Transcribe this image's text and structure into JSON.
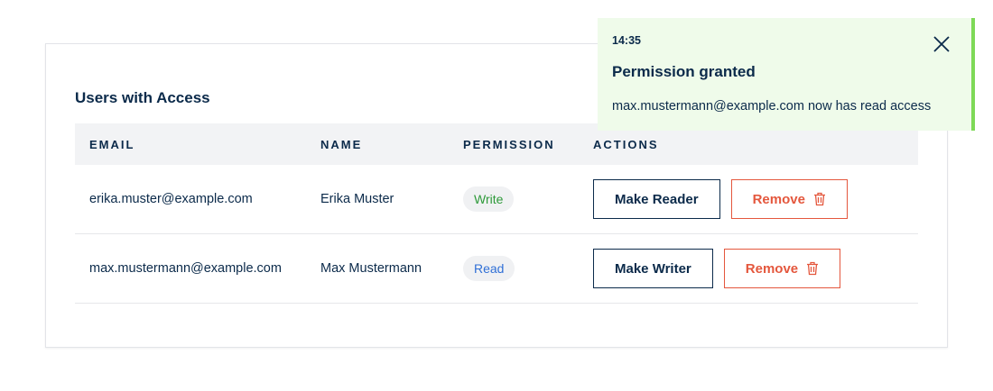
{
  "card": {
    "title": "Users with Access"
  },
  "table": {
    "headers": {
      "email": "EMAIL",
      "name": "NAME",
      "permission": "PERMISSION",
      "actions": "ACTIONS"
    },
    "rows": [
      {
        "email": "erika.muster@example.com",
        "name": "Erika Muster",
        "permission": "Write",
        "toggle_label": "Make Reader",
        "remove_label": "Remove"
      },
      {
        "email": "max.mustermann@example.com",
        "name": "Max Mustermann",
        "permission": "Read",
        "toggle_label": "Make Writer",
        "remove_label": "Remove"
      }
    ]
  },
  "toast": {
    "time": "14:35",
    "title": "Permission granted",
    "message": "max.mustermann@example.com now has read access",
    "close_icon": "close-icon"
  },
  "colors": {
    "text": "#0b2a4a",
    "danger": "#e4573d",
    "write_badge": "#2e9a3a",
    "read_badge": "#2f6fd6",
    "toast_bg": "#effbea",
    "toast_accent": "#7ed957"
  }
}
